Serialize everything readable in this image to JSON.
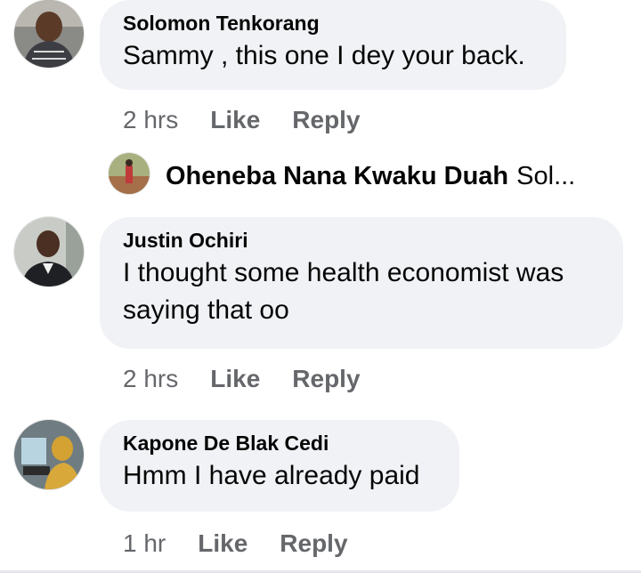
{
  "comments": [
    {
      "author": "Solomon Tenkorang",
      "text": "Sammy , this one I dey your back.",
      "time": "2 hrs",
      "like_label": "Like",
      "reply_label": "Reply",
      "reply_preview": {
        "author": "Oheneba Nana Kwaku Duah",
        "snippet": "Sol..."
      }
    },
    {
      "author": "Justin Ochiri",
      "text": "I thought some health economist was saying that oo",
      "time": "2 hrs",
      "like_label": "Like",
      "reply_label": "Reply"
    },
    {
      "author": "Kapone De Blak Cedi",
      "text": "Hmm I have already paid",
      "time": "1 hr",
      "like_label": "Like",
      "reply_label": "Reply"
    }
  ],
  "colors": {
    "bubble_bg": "#f0f2f5",
    "secondary_text": "#65676b",
    "primary_text": "#050505"
  }
}
